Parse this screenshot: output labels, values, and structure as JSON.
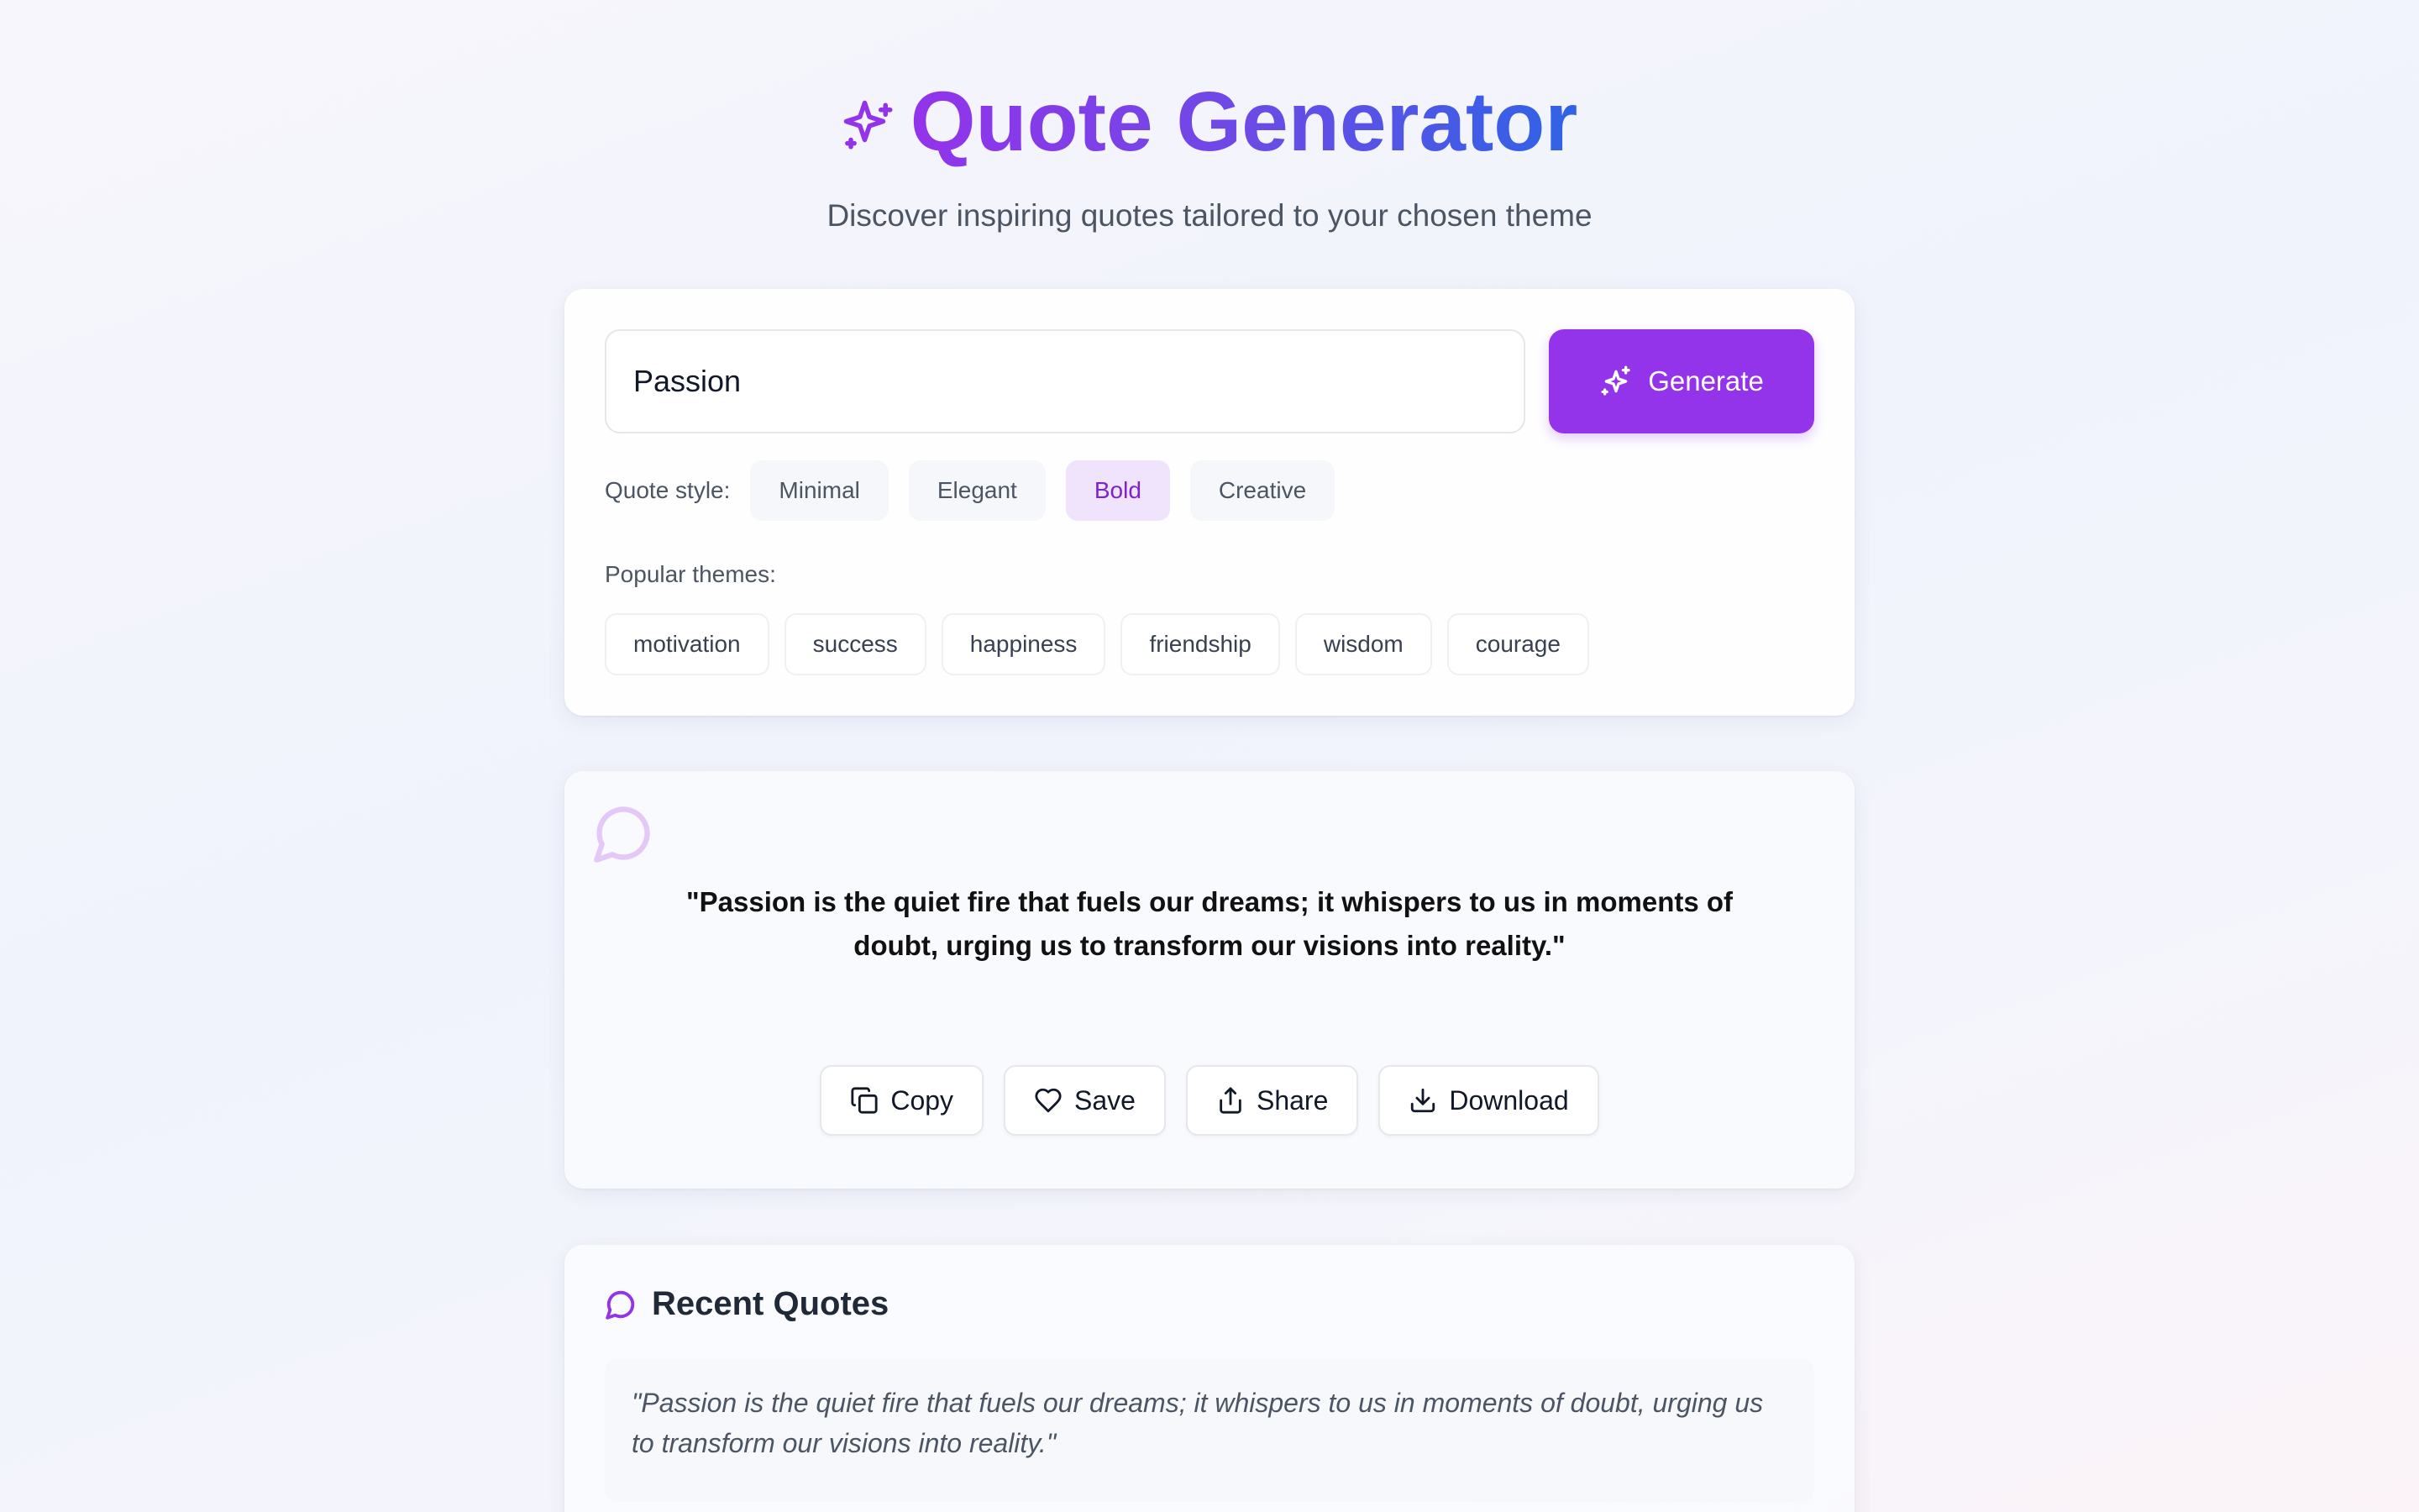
{
  "header": {
    "title": "Quote Generator",
    "subtitle": "Discover inspiring quotes tailored to your chosen theme"
  },
  "input": {
    "value": "Passion",
    "generate_label": "Generate"
  },
  "style": {
    "label": "Quote style:",
    "options": [
      "Minimal",
      "Elegant",
      "Bold",
      "Creative"
    ],
    "selected": "Bold"
  },
  "popular": {
    "label": "Popular themes:",
    "tags": [
      "motivation",
      "success",
      "happiness",
      "friendship",
      "wisdom",
      "courage"
    ]
  },
  "quote": {
    "text": "\"Passion is the quiet fire that fuels our dreams; it whispers to us in moments of doubt, urging us to transform our visions into reality.\""
  },
  "actions": {
    "copy": "Copy",
    "save": "Save",
    "share": "Share",
    "download": "Download"
  },
  "recent": {
    "title": "Recent Quotes",
    "items": [
      "\"Passion is the quiet fire that fuels our dreams; it whispers to us in moments of doubt, urging us to transform our visions into reality.\""
    ]
  },
  "colors": {
    "accent": "#9333ea",
    "title_gradient_end": "#2f63e6",
    "selected_chip_bg": "#f0e3fc"
  }
}
